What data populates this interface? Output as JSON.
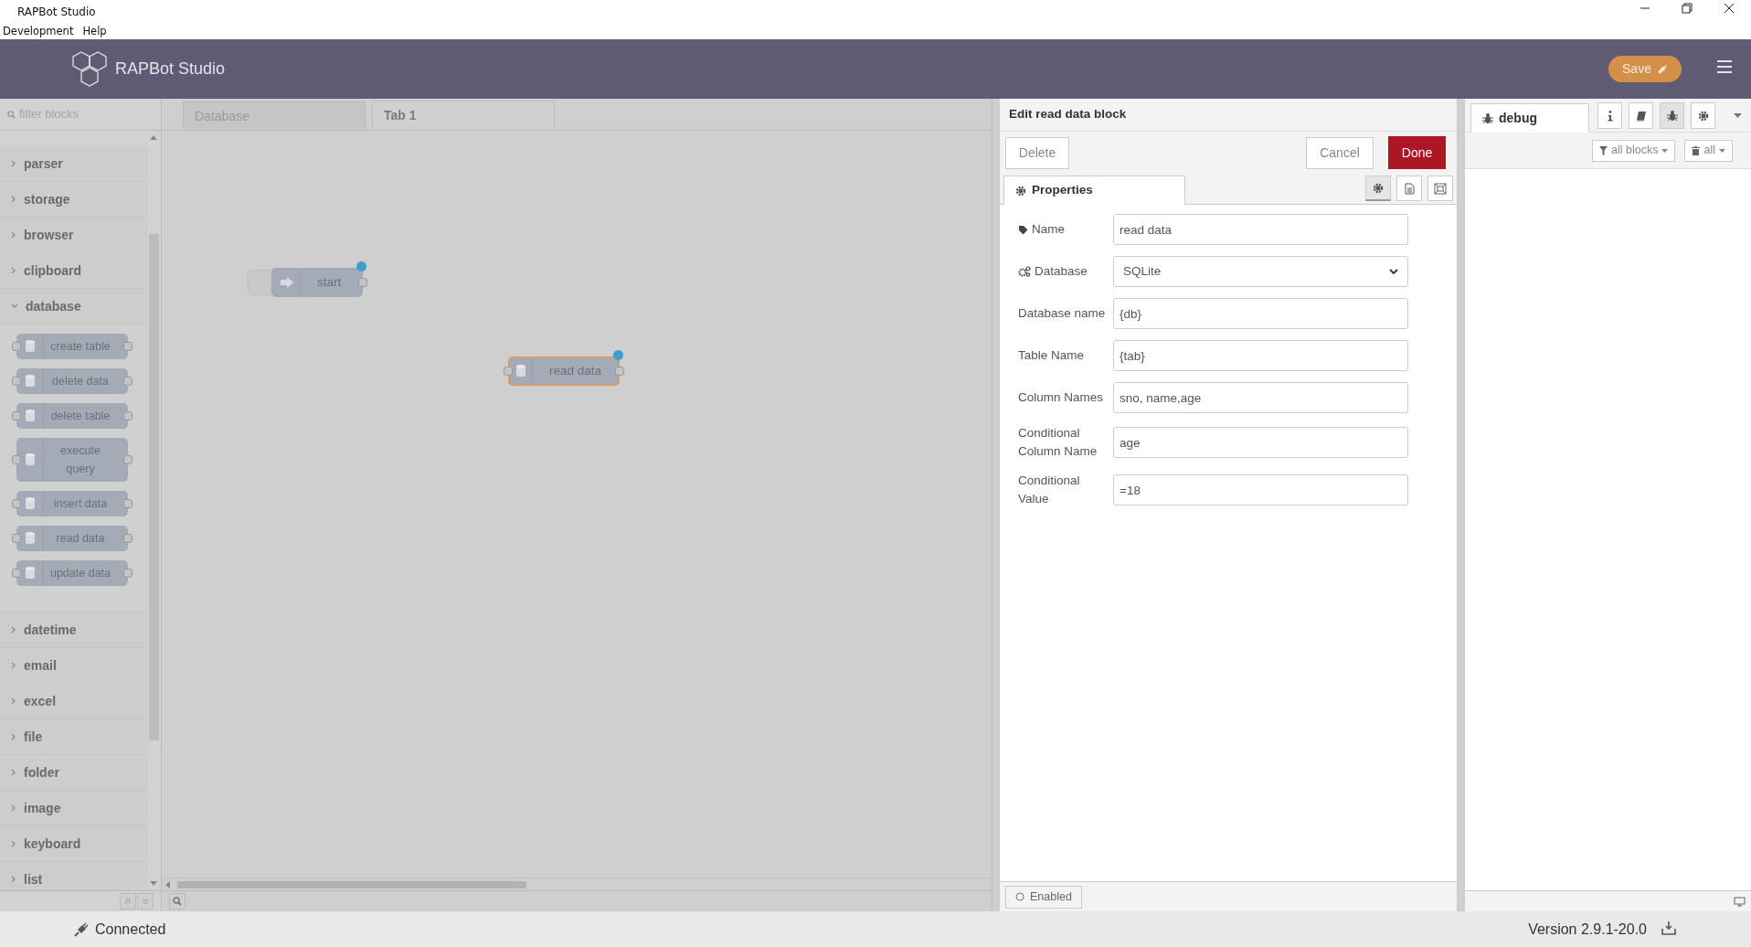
{
  "app": {
    "title": "RAPBot Studio",
    "menu": [
      "Development",
      "Help"
    ]
  },
  "header": {
    "brand": "RAPBot Studio",
    "save_label": "Save"
  },
  "palette": {
    "filter_placeholder": "filter blocks",
    "categories": [
      {
        "label": "parser",
        "expanded": false
      },
      {
        "label": "storage",
        "expanded": false
      },
      {
        "label": "browser",
        "expanded": false
      },
      {
        "label": "clipboard",
        "expanded": false
      },
      {
        "label": "database",
        "expanded": true,
        "blocks": [
          "create table",
          "delete data",
          "delete table",
          "execute query",
          "insert data",
          "read data",
          "update data"
        ]
      },
      {
        "label": "datetime",
        "expanded": false
      },
      {
        "label": "email",
        "expanded": false
      },
      {
        "label": "excel",
        "expanded": false
      },
      {
        "label": "file",
        "expanded": false
      },
      {
        "label": "folder",
        "expanded": false
      },
      {
        "label": "image",
        "expanded": false
      },
      {
        "label": "keyboard",
        "expanded": false
      },
      {
        "label": "list",
        "expanded": false
      }
    ]
  },
  "workspace": {
    "tabs": [
      {
        "label": "Database",
        "selected": false
      },
      {
        "label": "Tab 1",
        "selected": true
      }
    ],
    "nodes": [
      {
        "label": "start",
        "kind": "inject",
        "changed": true,
        "selected": false
      },
      {
        "label": "read data",
        "kind": "database",
        "changed": true,
        "selected": true
      }
    ]
  },
  "editor": {
    "title": "Edit read data block",
    "delete_label": "Delete",
    "cancel_label": "Cancel",
    "done_label": "Done",
    "tab": "Properties",
    "tab_icons": [
      {
        "kind": "gear",
        "selected": true
      },
      {
        "kind": "doc",
        "selected": false
      },
      {
        "kind": "frame",
        "selected": false
      }
    ],
    "fields": [
      {
        "label": "Name",
        "kind": "name",
        "value": "read data"
      },
      {
        "label": "Database",
        "kind": "select",
        "value": "SQLite"
      },
      {
        "label": "Database name",
        "kind": "text",
        "value": "{db}"
      },
      {
        "label": "Table Name",
        "kind": "text",
        "value": "{tab}"
      },
      {
        "label": "Column Names",
        "kind": "text",
        "value": "sno, name,age"
      },
      {
        "label": "Conditional Column Name",
        "kind": "text",
        "value": "age"
      },
      {
        "label": "Conditional Value",
        "kind": "text",
        "value": "=18"
      }
    ],
    "enabled_label": "Enabled"
  },
  "debug": {
    "tab": "debug",
    "tab_icons": [
      {
        "kind": "info",
        "selected": false
      },
      {
        "kind": "book",
        "selected": false
      },
      {
        "kind": "bug",
        "selected": true
      },
      {
        "kind": "gear",
        "selected": false
      }
    ],
    "filter_label": "all blocks",
    "clear_label": "all"
  },
  "status": {
    "connection": "Connected",
    "version": "Version 2.9.1-20.0"
  }
}
